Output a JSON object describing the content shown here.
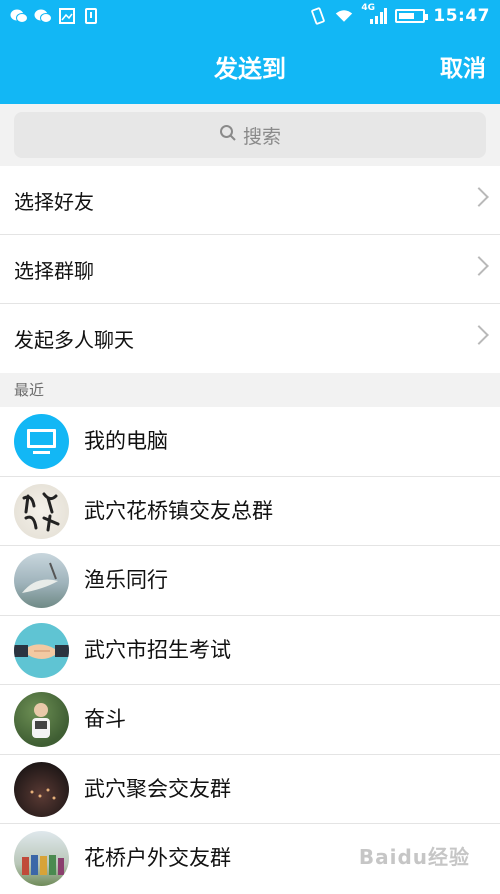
{
  "statusbar": {
    "time": "15:47",
    "network": "4G",
    "left_icons": [
      "wechat-icon",
      "wechat-icon",
      "image-icon",
      "sim-icon"
    ],
    "right_icons": [
      "vibrate-icon",
      "wifi-icon",
      "signal-icon",
      "battery-icon"
    ]
  },
  "header": {
    "title": "发送到",
    "cancel": "取消"
  },
  "search": {
    "placeholder": "搜索"
  },
  "menu": {
    "items": [
      {
        "label": "选择好友"
      },
      {
        "label": "选择群聊"
      },
      {
        "label": "发起多人聊天"
      }
    ]
  },
  "recent": {
    "section_label": "最近",
    "items": [
      {
        "name": "我的电脑",
        "avatar": "computer-icon"
      },
      {
        "name": "武穴花桥镇交友总群",
        "avatar": "calligraphy-avatar"
      },
      {
        "name": "渔乐同行",
        "avatar": "fish-avatar"
      },
      {
        "name": "武穴市招生考试",
        "avatar": "handshake-avatar"
      },
      {
        "name": "奋斗",
        "avatar": "child-avatar"
      },
      {
        "name": "武穴聚会交友群",
        "avatar": "night-avatar"
      },
      {
        "name": "花桥户外交友群",
        "avatar": "group-photo-avatar"
      }
    ]
  },
  "colors": {
    "accent": "#12b7f5",
    "background": "#f2f2f2"
  },
  "watermark": "Baidu经验"
}
